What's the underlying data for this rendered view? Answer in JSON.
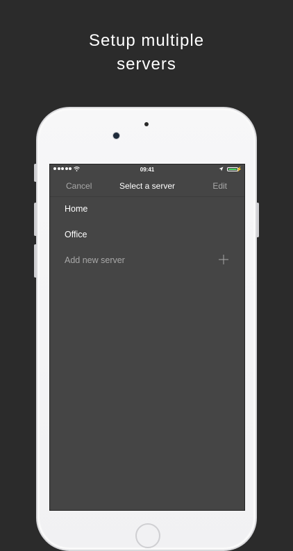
{
  "headline": {
    "line1": "Setup multiple",
    "line2": "servers"
  },
  "status_bar": {
    "time": "09:41",
    "signal_icon": "signal-dots-icon",
    "wifi_icon": "wifi-icon",
    "location_icon": "location-arrow-icon",
    "battery_icon": "battery-icon",
    "battery_color": "#4cd964"
  },
  "navbar": {
    "cancel_label": "Cancel",
    "title": "Select a server",
    "edit_label": "Edit"
  },
  "servers": {
    "items": [
      {
        "label": "Home"
      },
      {
        "label": "Office"
      }
    ],
    "add_label": "Add new server",
    "add_icon": "plus-icon"
  },
  "colors": {
    "background": "#2b2b2b",
    "screen": "#454545",
    "accent_muted": "#a9a9a9",
    "text": "#ffffff"
  }
}
